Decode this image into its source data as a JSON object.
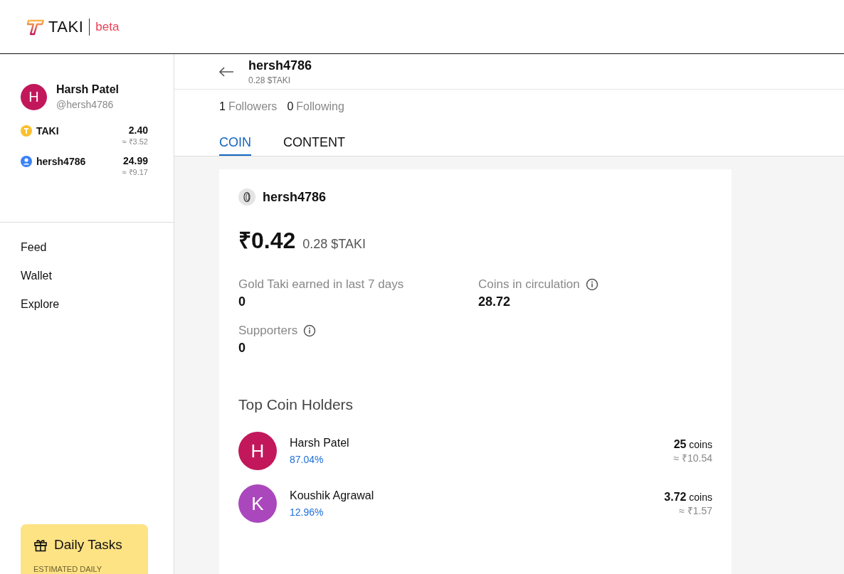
{
  "header": {
    "logo_text": "TAKI",
    "logo_badge": "beta"
  },
  "sidebar": {
    "profile": {
      "initial": "H",
      "name": "Harsh Patel",
      "handle": "@hersh4786",
      "color": "#c2185b"
    },
    "wallet": [
      {
        "kind": "taki",
        "label": "TAKI",
        "amount": "2.40",
        "value": "≈ ₹3.52"
      },
      {
        "kind": "user",
        "label": "hersh4786",
        "amount": "24.99",
        "value": "≈ ₹9.17"
      }
    ],
    "nav": [
      {
        "label": "Feed"
      },
      {
        "label": "Wallet"
      },
      {
        "label": "Explore"
      }
    ],
    "daily_tasks": {
      "title": "Daily Tasks",
      "caption": "ESTIMATED DAILY"
    }
  },
  "profile_header": {
    "title": "hersh4786",
    "subtitle": "0.28 $TAKI"
  },
  "follow_stats": [
    {
      "count": "1",
      "label": "Followers"
    },
    {
      "count": "0",
      "label": "Following"
    }
  ],
  "tabs": [
    {
      "label": "COIN",
      "selected": true
    },
    {
      "label": "CONTENT",
      "selected": false
    }
  ],
  "coin": {
    "name": "hersh4786",
    "price": "₹0.42",
    "price_taki": "0.28 $TAKI",
    "stats": [
      {
        "label": "Gold Taki earned in last 7 days",
        "value": "0",
        "info": false
      },
      {
        "label": "Coins in circulation",
        "value": "28.72",
        "info": true
      },
      {
        "label": "Supporters",
        "value": "0",
        "info": true
      }
    ],
    "holders_title": "Top Coin Holders",
    "holders": [
      {
        "initial": "H",
        "name": "Harsh Patel",
        "share": "87.04%",
        "coins": "25",
        "unit": "coins",
        "value": "≈ ₹10.54",
        "color": "#c2185b"
      },
      {
        "initial": "K",
        "name": "Koushik Agrawal",
        "share": "12.96%",
        "coins": "3.72",
        "unit": "coins",
        "value": "≈ ₹1.57",
        "color": "#ab47bc"
      }
    ]
  }
}
